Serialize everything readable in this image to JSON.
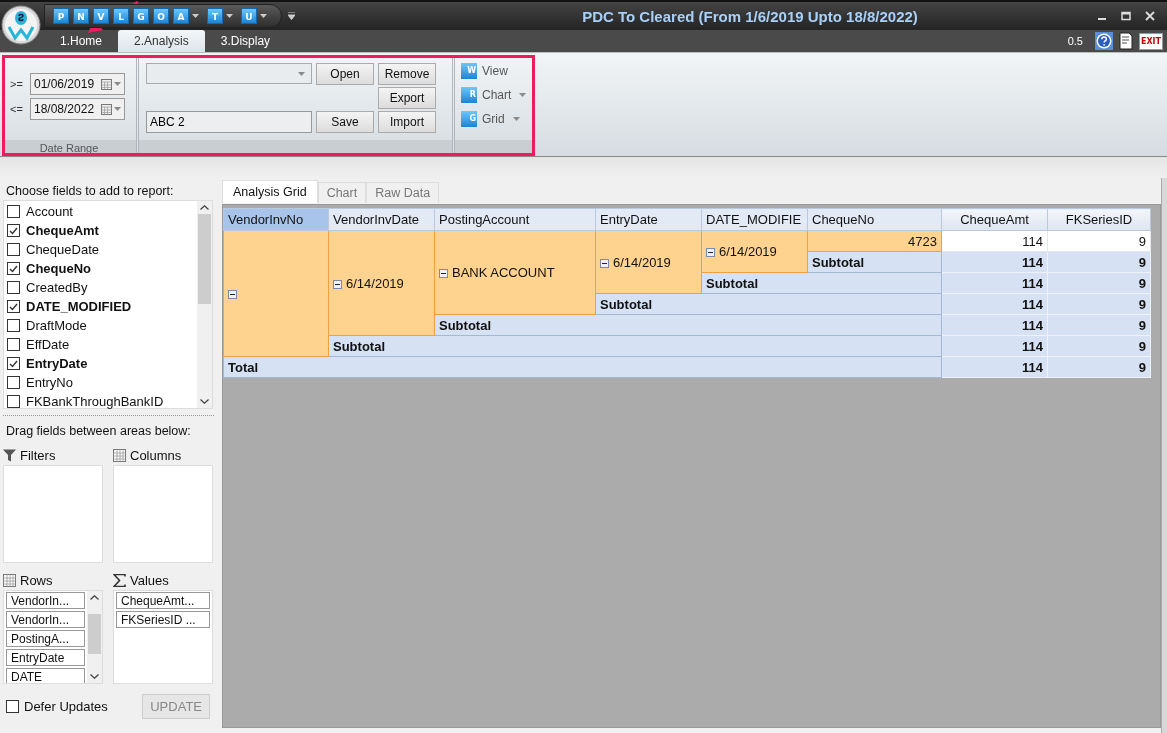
{
  "window": {
    "title": "PDC To Cleared (From 1/6/2019 Upto 18/8/2022)"
  },
  "quick_access": [
    {
      "letter": "P",
      "dropdown": false
    },
    {
      "letter": "N",
      "dropdown": false
    },
    {
      "letter": "V",
      "dropdown": false
    },
    {
      "letter": "L",
      "dropdown": false
    },
    {
      "letter": "G",
      "dropdown": false
    },
    {
      "letter": "O",
      "dropdown": false
    },
    {
      "letter": "A",
      "dropdown": true
    },
    {
      "letter": "T",
      "dropdown": true
    },
    {
      "letter": "U",
      "dropdown": true
    }
  ],
  "ribbon_tabs": [
    {
      "label": "1.Home",
      "selected": false
    },
    {
      "label": "2.Analysis",
      "selected": true
    },
    {
      "label": "3.Display",
      "selected": false
    }
  ],
  "version": "0.5",
  "exit_label": "EXIT",
  "date_range": {
    "caption": "Date Range",
    "from_operator": ">=",
    "from": "01/06/2019",
    "to_operator": "<=",
    "to": "18/08/2022"
  },
  "layout_group": {
    "report_name": "ABC 2",
    "buttons": [
      "Open",
      "Remove",
      "Export",
      "Save",
      "Import"
    ]
  },
  "view_group": [
    {
      "label": "View",
      "icon": "W",
      "dropdown": false
    },
    {
      "label": "Chart",
      "icon": "R",
      "dropdown": true
    },
    {
      "label": "Grid",
      "icon": "G",
      "dropdown": true
    }
  ],
  "field_list": {
    "title": "Choose fields to add to report:",
    "fields": [
      {
        "name": "Account",
        "checked": false
      },
      {
        "name": "ChequeAmt",
        "checked": true
      },
      {
        "name": "ChequeDate",
        "checked": false
      },
      {
        "name": "ChequeNo",
        "checked": true
      },
      {
        "name": "CreatedBy",
        "checked": false
      },
      {
        "name": "DATE_MODIFIED",
        "checked": true
      },
      {
        "name": "DraftMode",
        "checked": false
      },
      {
        "name": "EffDate",
        "checked": false
      },
      {
        "name": "EntryDate",
        "checked": true
      },
      {
        "name": "EntryNo",
        "checked": false
      },
      {
        "name": "FKBankThroughBankID",
        "checked": false
      }
    ]
  },
  "areas_hint": "Drag fields between areas below:",
  "areas": {
    "filters": {
      "title": "Filters"
    },
    "columns": {
      "title": "Columns"
    },
    "rows": {
      "title": "Rows",
      "items": [
        "VendorIn...",
        "VendorIn...",
        "PostingA...",
        "EntryDate",
        "DATE"
      ]
    },
    "values": {
      "title": "Values",
      "items": [
        "ChequeAmt...",
        "FKSeriesID ..."
      ]
    }
  },
  "defer_updates": {
    "label": "Defer Updates",
    "checked": false
  },
  "update_button": {
    "label": "UPDATE",
    "disabled": true
  },
  "view_tabs": [
    {
      "label": "Analysis Grid",
      "selected": true
    },
    {
      "label": "Chart",
      "selected": false
    },
    {
      "label": "Raw Data",
      "selected": false
    }
  ],
  "pivot": {
    "row_fields": [
      {
        "name": "VendorInvNo",
        "selected": true
      },
      {
        "name": "VendorInvDate",
        "selected": false
      },
      {
        "name": "PostingAccount",
        "selected": false
      },
      {
        "name": "EntryDate",
        "selected": false
      },
      {
        "name": "DATE_MODIFIE",
        "selected": false
      },
      {
        "name": "ChequeNo",
        "selected": false
      }
    ],
    "data_fields": [
      "ChequeAmt",
      "FKSeriesID"
    ],
    "row_tree": [
      {
        "expanded": true,
        "subtotal": {
          "label": "Subtotal",
          "values": [
            "114",
            "9"
          ]
        },
        "children": [
          {
            "label": "6/14/2019",
            "expanded": true,
            "subtotal": {
              "label": "Subtotal",
              "values": [
                "114",
                "9"
              ]
            },
            "children": [
              {
                "label": "BANK ACCOUNT",
                "expanded": true,
                "subtotal": {
                  "label": "Subtotal",
                  "values": [
                    "114",
                    "9"
                  ]
                },
                "children": [
                  {
                    "label": "6/14/2019",
                    "expanded": true,
                    "subtotal": {
                      "label": "Subtotal",
                      "values": [
                        "114",
                        "9"
                      ]
                    },
                    "children": [
                      {
                        "label": "6/14/2019",
                        "expanded": true,
                        "subtotal": {
                          "label": "Subtotal",
                          "values": [
                            "114",
                            "9"
                          ]
                        },
                        "children": [
                          {
                            "label": "4723",
                            "values": [
                              "114",
                              "9"
                            ]
                          }
                        ]
                      }
                    ]
                  }
                ]
              }
            ]
          }
        ]
      }
    ],
    "total": {
      "label": "Total",
      "values": [
        "114",
        "9"
      ]
    }
  }
}
